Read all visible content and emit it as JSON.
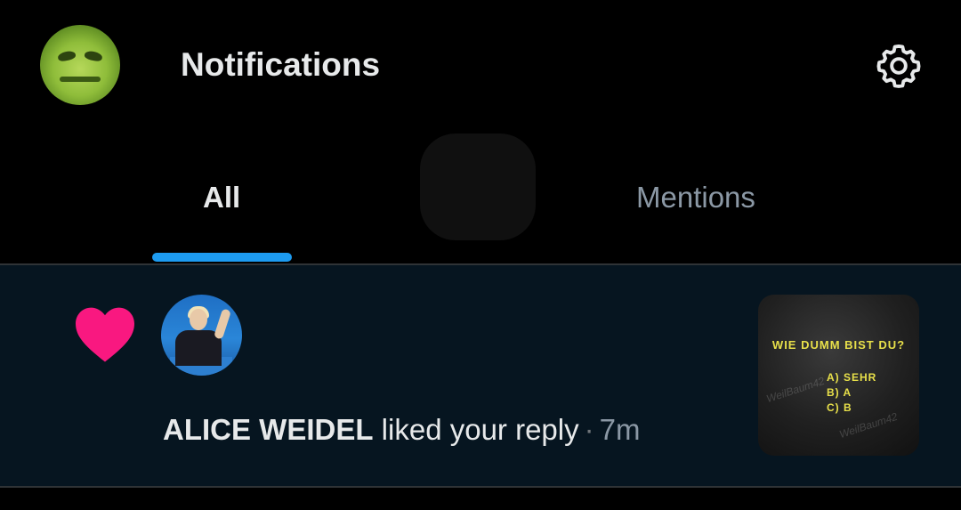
{
  "header": {
    "title": "Notifications"
  },
  "tabs": [
    {
      "label": "All",
      "active": true
    },
    {
      "label": "Mentions",
      "active": false
    }
  ],
  "notification": {
    "user_name": "ALICE WEIDEL",
    "action": "liked your reply",
    "separator": "·",
    "time": "7m",
    "icon": "heart-icon",
    "thumbnail": {
      "question": "WIE DUMM BIST DU?",
      "options": [
        "A) SEHR",
        "B) A",
        "C) B"
      ],
      "watermark": "WeilBaum42"
    }
  },
  "colors": {
    "background": "#000000",
    "notification_bg": "#061520",
    "accent": "#1d9bf0",
    "like": "#f91880"
  }
}
